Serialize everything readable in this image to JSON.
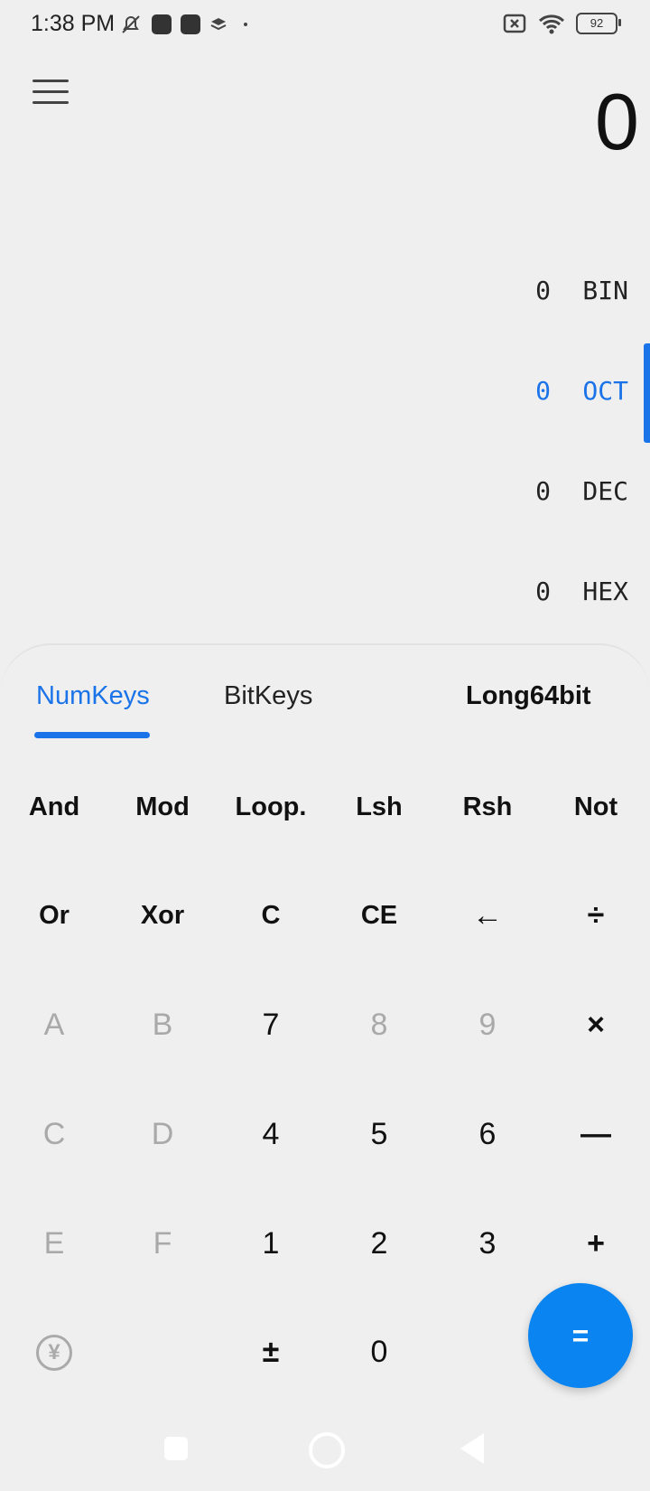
{
  "status_bar": {
    "time": "1:38 PM",
    "battery": "92"
  },
  "display": {
    "value": "0"
  },
  "bases": [
    {
      "value": "0",
      "label": "BIN",
      "active": false
    },
    {
      "value": "0",
      "label": "OCT",
      "active": true
    },
    {
      "value": "0",
      "label": "DEC",
      "active": false
    },
    {
      "value": "0",
      "label": "HEX",
      "active": false
    }
  ],
  "tabs": {
    "numkeys": "NumKeys",
    "bitkeys": "BitKeys",
    "mode": "Long64bit"
  },
  "keys": {
    "row1": [
      "And",
      "Mod",
      "Loop.",
      "Lsh",
      "Rsh",
      "Not"
    ],
    "row2": [
      "Or",
      "Xor",
      "C",
      "CE",
      "←",
      "÷"
    ],
    "row3": [
      "A",
      "B",
      "7",
      "8",
      "9",
      "×"
    ],
    "row4": [
      "C",
      "D",
      "4",
      "5",
      "6",
      "—"
    ],
    "row5": [
      "E",
      "F",
      "1",
      "2",
      "3",
      "+"
    ],
    "row6": [
      "¥",
      "±",
      "0"
    ]
  },
  "equals": "=",
  "colors": {
    "accent": "#1a73e8",
    "equals_bg": "#0a84f0",
    "disabled": "#a9a9a9"
  }
}
